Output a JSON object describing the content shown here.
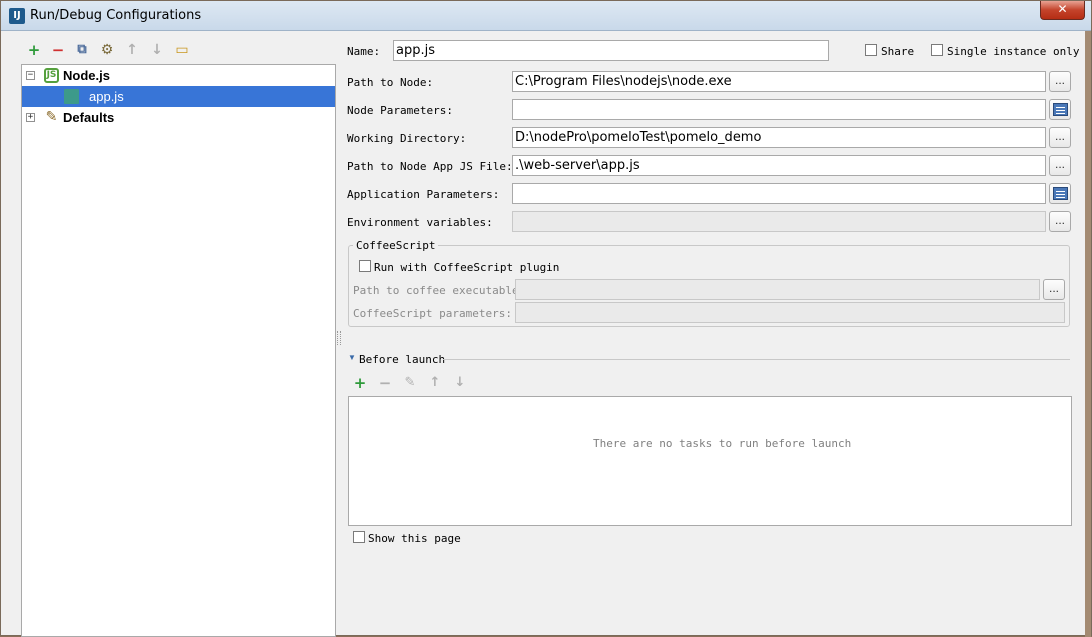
{
  "window": {
    "title": "Run/Debug Configurations",
    "app_icon": "IJ",
    "close_glyph": "✕"
  },
  "toolbar": {
    "add_glyph": "+",
    "remove_glyph": "−",
    "copy_glyph": "⧉",
    "edit_defaults_glyph": "⚙",
    "up_glyph": "↑",
    "down_glyph": "↓",
    "folder_glyph": "▭"
  },
  "tree": {
    "items": [
      {
        "label": "Node.js",
        "icon": "JS",
        "expander": "−"
      },
      {
        "label": "app.js",
        "icon": "js"
      },
      {
        "label": "Defaults",
        "icon": "✎",
        "expander": "+"
      }
    ]
  },
  "form": {
    "name_label": "Name:",
    "name_value": "app.js",
    "share_label": "Share",
    "single_instance_label": "Single instance only",
    "path_to_node_label": "Path to Node:",
    "path_to_node_value": "C:\\Program Files\\nodejs\\node.exe",
    "node_parameters_label": "Node Parameters:",
    "node_parameters_value": "",
    "working_directory_label": "Working Directory:",
    "working_directory_value": "D:\\nodePro\\pomeloTest\\pomelo_demo",
    "app_js_file_label": "Path to Node App JS File:",
    "app_js_file_value": ".\\web-server\\app.js",
    "app_parameters_label": "Application Parameters:",
    "app_parameters_value": "",
    "env_variables_label": "Environment variables:",
    "env_variables_value": "",
    "dots": "..."
  },
  "coffeescript": {
    "group_title": "CoffeeScript",
    "run_with_plugin_label": "Run with CoffeeScript plugin",
    "coffee_exec_label": "Path to coffee executable:",
    "coffee_params_label": "CoffeeScript parameters:"
  },
  "before_launch": {
    "title": "Before launch",
    "arrow": "▼",
    "add_glyph": "+",
    "remove_glyph": "−",
    "edit_glyph": "✎",
    "up_glyph": "↑",
    "down_glyph": "↓",
    "empty_text": "There are no tasks to run before launch",
    "show_page_label": "Show this page"
  },
  "colors": {
    "selection": "#3875d7",
    "add_green": "#2e9a3a",
    "remove_red": "#d03030"
  }
}
